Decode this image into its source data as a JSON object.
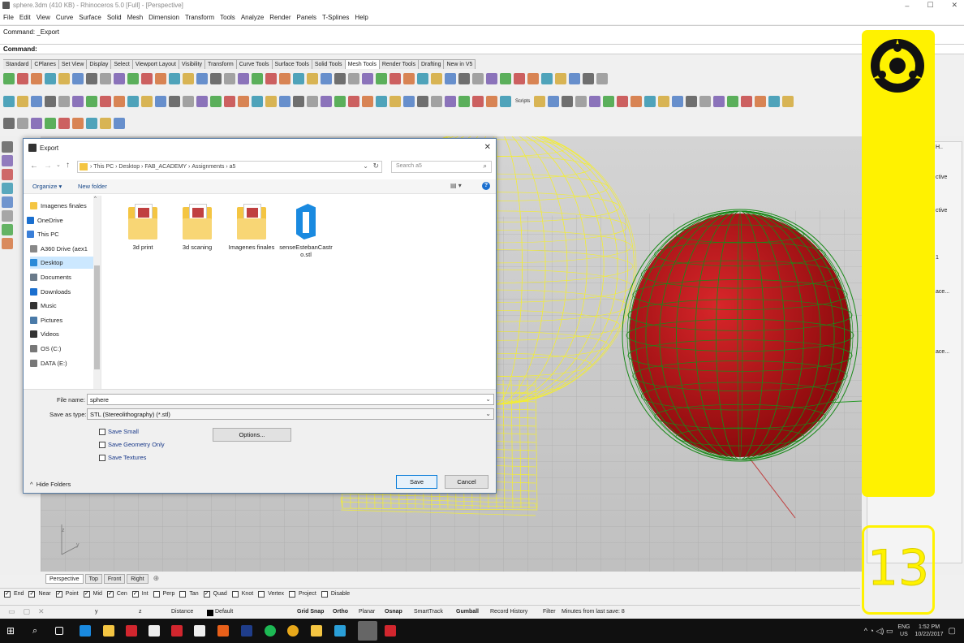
{
  "titlebar": {
    "title": "sphere.3dm (410 KB) - Rhinoceros 5.0 [Full] - [Perspective]",
    "minimize": "–",
    "maximize": "☐",
    "close": "✕"
  },
  "menubar": [
    "File",
    "Edit",
    "View",
    "Curve",
    "Surface",
    "Solid",
    "Mesh",
    "Dimension",
    "Transform",
    "Tools",
    "Analyze",
    "Render",
    "Panels",
    "T-Splines",
    "Help"
  ],
  "command": {
    "history": "Command: _Export",
    "prompt": "Command:"
  },
  "toolbar_tabs": [
    "Standard",
    "CPlanes",
    "Set View",
    "Display",
    "Select",
    "Viewport Layout",
    "Visibility",
    "Transform",
    "Curve Tools",
    "Surface Tools",
    "Solid Tools",
    "Mesh Tools",
    "Render Tools",
    "Drafting",
    "New in V5"
  ],
  "toolbar_tabs_active": "Mesh Tools",
  "scripts_label": "Scripts",
  "dialog": {
    "title": "Export",
    "path": [
      "This PC",
      "Desktop",
      "FAB_ACADEMY",
      "Assignments",
      "a5"
    ],
    "search_placeholder": "Search a5",
    "organize": "Organize ▾",
    "new_folder": "New folder",
    "nav_items": [
      {
        "label": "Imagenes finales",
        "icon": "folder-icon"
      },
      {
        "label": "OneDrive",
        "icon": "cloud-icon"
      },
      {
        "label": "This PC",
        "icon": "computer-icon"
      },
      {
        "label": "A360 Drive (aex1",
        "icon": "drive-icon"
      },
      {
        "label": "Desktop",
        "icon": "desktop-icon"
      },
      {
        "label": "Documents",
        "icon": "documents-icon"
      },
      {
        "label": "Downloads",
        "icon": "downloads-icon"
      },
      {
        "label": "Music",
        "icon": "music-icon"
      },
      {
        "label": "Pictures",
        "icon": "pictures-icon"
      },
      {
        "label": "Videos",
        "icon": "videos-icon"
      },
      {
        "label": "OS (C:)",
        "icon": "disk-icon"
      },
      {
        "label": "DATA (E:)",
        "icon": "disk-icon"
      }
    ],
    "nav_selected": "Desktop",
    "files": [
      {
        "name": "3d print",
        "type": "folder"
      },
      {
        "name": "3d scaning",
        "type": "folder"
      },
      {
        "name": "Imagenes finales",
        "type": "folder"
      },
      {
        "name": "senseEstebanCastro.stl",
        "type": "stl"
      }
    ],
    "file_name_label": "File name:",
    "file_name_value": "sphere",
    "save_type_label": "Save as type:",
    "save_type_value": "STL (Stereolithography) (*.stl)",
    "options": [
      {
        "label": "Save Small",
        "checked": false
      },
      {
        "label": "Save Geometry Only",
        "checked": false
      },
      {
        "label": "Save Textures",
        "checked": false
      }
    ],
    "options_button": "Options...",
    "hide_folders": "Hide Folders",
    "save": "Save",
    "cancel": "Cancel"
  },
  "view_tabs": [
    "Perspective",
    "Top",
    "Front",
    "Right"
  ],
  "view_tab_active": "Perspective",
  "osnaps": [
    {
      "label": "End",
      "checked": true
    },
    {
      "label": "Near",
      "checked": true
    },
    {
      "label": "Point",
      "checked": true
    },
    {
      "label": "Mid",
      "checked": true
    },
    {
      "label": "Cen",
      "checked": true
    },
    {
      "label": "Int",
      "checked": true
    },
    {
      "label": "Perp",
      "checked": false
    },
    {
      "label": "Tan",
      "checked": false
    },
    {
      "label": "Quad",
      "checked": true
    },
    {
      "label": "Knot",
      "checked": false
    },
    {
      "label": "Vertex",
      "checked": false
    },
    {
      "label": "Project",
      "checked": false
    },
    {
      "label": "Disable",
      "checked": false
    }
  ],
  "status": {
    "y": "y",
    "z": "z",
    "distance": "Distance",
    "layer": "Default",
    "grid_snap": "Grid Snap",
    "ortho": "Ortho",
    "planar": "Planar",
    "osnap": "Osnap",
    "smarttrack": "SmartTrack",
    "gumball": "Gumball",
    "record_history": "Record History",
    "filter": "Filter",
    "save_info": "Minutes from last save: 8"
  },
  "right_panel": [
    "ctive",
    "ctive",
    "1",
    "ace...",
    "ace..."
  ],
  "right_panel_head": "H..",
  "overlay_number": "13",
  "tray": {
    "lang": "ENG",
    "region": "US",
    "time": "1:52 PM",
    "date": "10/22/2017"
  },
  "colors": {
    "yellow": "#fff200",
    "sphere_red": "#c0161a",
    "mesh_green": "#1a8a1a",
    "wire_yellow": "#f4ee30",
    "ps_box": "#1f3d8a"
  }
}
